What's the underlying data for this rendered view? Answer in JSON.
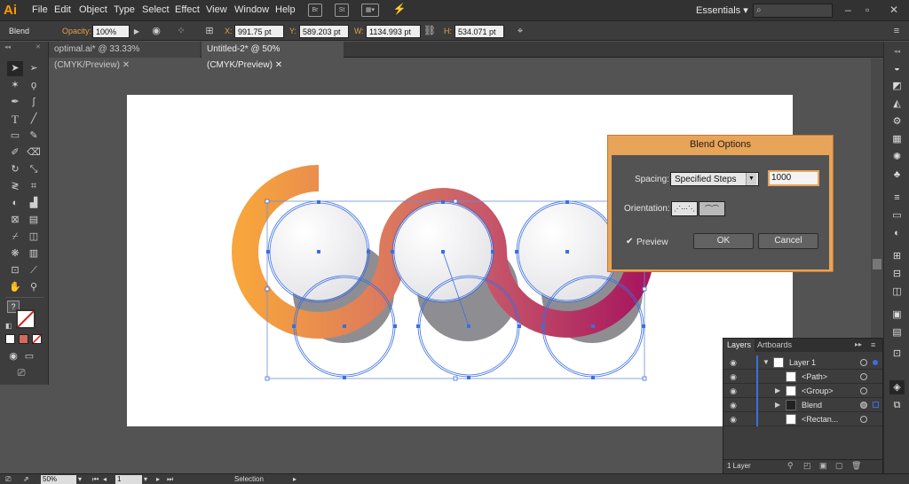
{
  "app": {
    "logo": "Ai"
  },
  "menu": [
    "File",
    "Edit",
    "Object",
    "Type",
    "Select",
    "Effect",
    "View",
    "Window",
    "Help"
  ],
  "menubar_icons": {
    "br": "Br",
    "st": "St"
  },
  "workspace": "Essentials",
  "controlbar": {
    "selection": "Blend",
    "opacity_label": "Opacity:",
    "opacity_value": "100%",
    "x_label": "X:",
    "x_value": "991.75 pt",
    "y_label": "Y:",
    "y_value": "589.203 pt",
    "w_label": "W:",
    "w_value": "1134.993 pt",
    "h_label": "H:",
    "h_value": "534.071 pt"
  },
  "tabs": [
    {
      "label": "optimal.ai* @ 33.33% (CMYK/Preview)"
    },
    {
      "label": "Untitled-2* @ 50% (CMYK/Preview)"
    }
  ],
  "blend_dialog": {
    "title": "Blend Options",
    "spacing_label": "Spacing:",
    "spacing_value": "Specified Steps",
    "steps_value": "1000",
    "orientation_label": "Orientation:",
    "preview_label": "Preview",
    "ok_label": "OK",
    "cancel_label": "Cancel"
  },
  "layers_panel": {
    "tabs": [
      "Layers",
      "Artboards"
    ],
    "rows": [
      {
        "label": "Layer 1"
      },
      {
        "label": "<Path>"
      },
      {
        "label": "<Group>"
      },
      {
        "label": "Blend"
      },
      {
        "label": "<Rectan..."
      }
    ],
    "count": "1 Layer"
  },
  "status": {
    "zoom": "50%",
    "page": "1",
    "tool": "Selection"
  },
  "colors": {
    "accent": "#e8a458",
    "gradient_start": "#f7a53c",
    "gradient_mid": "#c85a6a",
    "gradient_end": "#a8195e",
    "selection_blue": "#3a6fe0"
  },
  "icons": {
    "tools": [
      "selection-icon",
      "direct-selection-icon",
      "magic-wand-icon",
      "lasso-icon",
      "pen-icon",
      "curvature-icon",
      "type-icon",
      "line-icon",
      "rectangle-icon",
      "paintbrush-icon",
      "shaper-icon",
      "eraser-icon",
      "rotate-icon",
      "scale-icon",
      "width-icon",
      "free-transform-icon",
      "shape-builder-icon",
      "perspective-icon",
      "mesh-icon",
      "gradient-icon",
      "eyedropper-icon",
      "blend-icon",
      "symbol-sprayer-icon",
      "column-graph-icon",
      "artboard-icon",
      "slice-icon",
      "hand-icon",
      "zoom-icon"
    ]
  }
}
